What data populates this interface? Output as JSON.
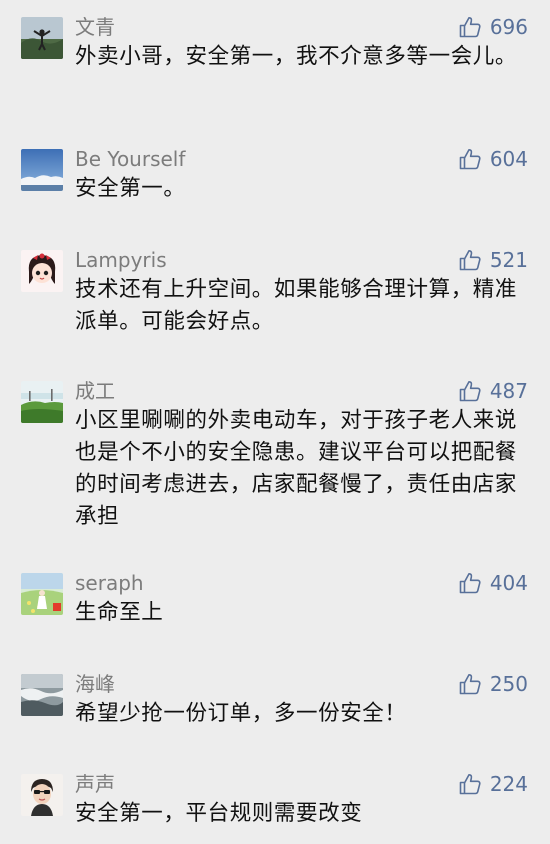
{
  "comments": [
    {
      "name": "文青",
      "likes": "696",
      "text": "外卖小哥，安全第一，我不介意多等一会儿。",
      "avatar_icon": "landscape-avatar"
    },
    {
      "name": "Be Yourself",
      "likes": "604",
      "text": "安全第一。",
      "avatar_icon": "sky-avatar"
    },
    {
      "name": "Lampyris",
      "likes": "521",
      "text": "技术还有上升空间。如果能够合理计算，精准派单。可能会好点。",
      "avatar_icon": "cartoon-girl-avatar"
    },
    {
      "name": "成工",
      "likes": "487",
      "text": "小区里唰唰的外卖电动车，对于孩子老人来说也是个不小的安全隐患。建议平台可以把配餐的时间考虑进去，店家配餐慢了，责任由店家承担",
      "avatar_icon": "green-field-avatar"
    },
    {
      "name": "seraph",
      "likes": "404",
      "text": "生命至上",
      "avatar_icon": "flower-avatar"
    },
    {
      "name": "海峰",
      "likes": "250",
      "text": "希望少抢一份订单，多一份安全！",
      "avatar_icon": "sea-waves-avatar"
    },
    {
      "name": "声声",
      "likes": "224",
      "text": "安全第一，平台规则需要改变",
      "avatar_icon": "child-avatar"
    }
  ],
  "colors": {
    "background": "#ededed",
    "name": "#7c7c7c",
    "like_count": "#587099",
    "text": "#111111"
  }
}
